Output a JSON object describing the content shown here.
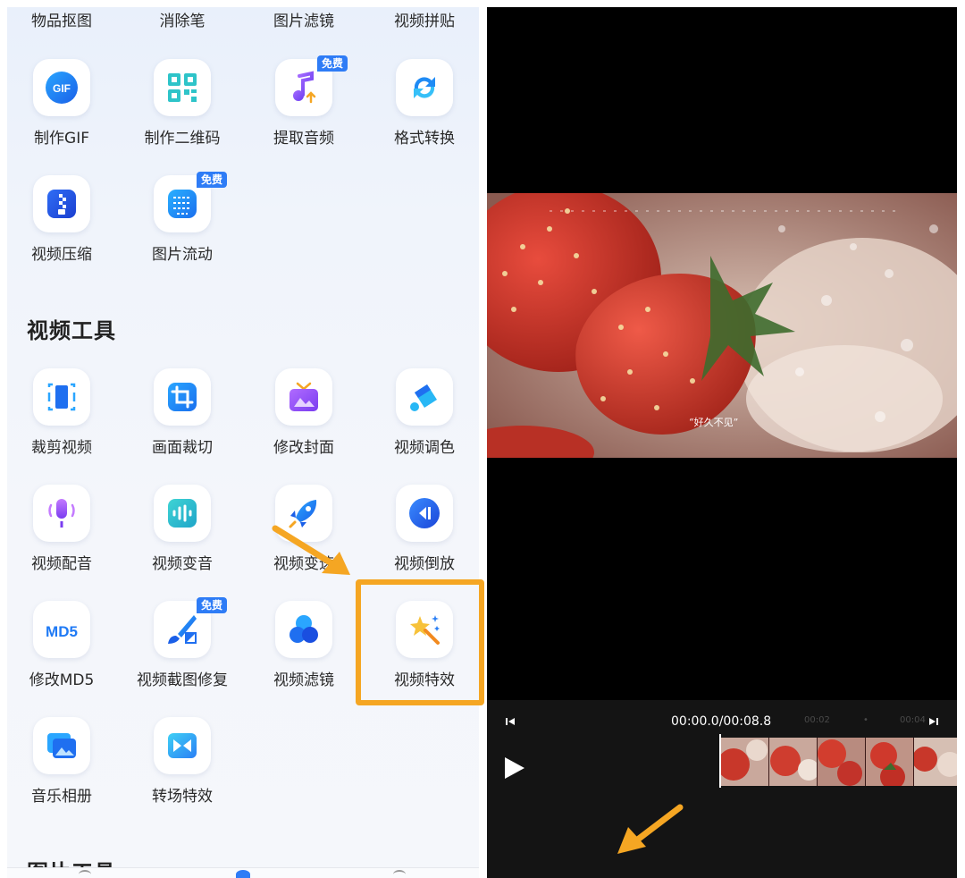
{
  "left": {
    "top_row": [
      "物品抠图",
      "消除笔",
      "图片滤镜",
      "视频拼贴"
    ],
    "tools_row1": [
      {
        "label": "制作GIF",
        "icon": "gif-icon",
        "icon_text": "GIF"
      },
      {
        "label": "制作二维码",
        "icon": "qr-code-icon"
      },
      {
        "label": "提取音频",
        "icon": "music-note-icon",
        "badge": "免费"
      },
      {
        "label": "格式转换",
        "icon": "convert-arrows-icon"
      }
    ],
    "tools_row2": [
      {
        "label": "视频压缩",
        "icon": "compress-icon"
      },
      {
        "label": "图片流动",
        "icon": "image-flow-icon",
        "badge": "免费"
      }
    ],
    "video_section_title": "视频工具",
    "video_tools": [
      {
        "label": "裁剪视频",
        "icon": "crop-video-icon"
      },
      {
        "label": "画面裁切",
        "icon": "crop-frame-icon"
      },
      {
        "label": "修改封面",
        "icon": "cover-tv-icon"
      },
      {
        "label": "视频调色",
        "icon": "color-bucket-icon"
      },
      {
        "label": "视频配音",
        "icon": "microphone-icon"
      },
      {
        "label": "视频变音",
        "icon": "voice-wave-icon"
      },
      {
        "label": "视频变速",
        "icon": "rocket-icon"
      },
      {
        "label": "视频倒放",
        "icon": "rewind-icon"
      },
      {
        "label": "修改MD5",
        "icon": "md5-icon",
        "icon_text": "MD5"
      },
      {
        "label": "视频截图修复",
        "icon": "brush-repair-icon",
        "badge": "免费"
      },
      {
        "label": "视频滤镜",
        "icon": "filter-circles-icon"
      },
      {
        "label": "视频特效",
        "icon": "magic-wand-icon"
      },
      {
        "label": "音乐相册",
        "icon": "photo-album-icon"
      },
      {
        "label": "转场特效",
        "icon": "transition-icon"
      }
    ],
    "next_section_title": "图片工具"
  },
  "right": {
    "video_caption": "“好久不见”",
    "timecode_current": "00:00.0",
    "timecode_separator": "/",
    "timecode_total": "00:08.8",
    "ticks": [
      "00:02",
      "•",
      "00:04"
    ]
  },
  "colors": {
    "accent_orange": "#f5a623",
    "badge_blue": "#2e7cf6",
    "editor_bg": "#141414"
  }
}
